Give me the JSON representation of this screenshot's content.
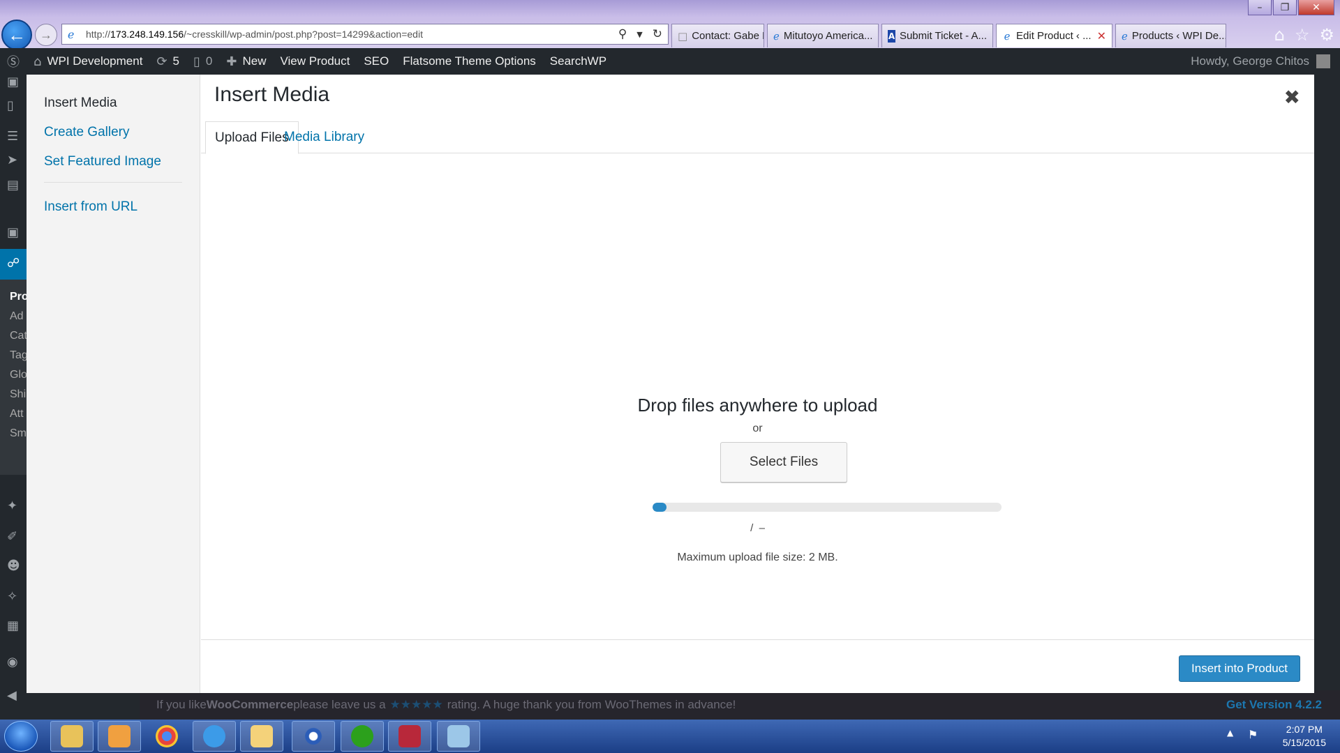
{
  "browser": {
    "url_prefix": "http://",
    "url_host": "173.248.149.156",
    "url_path": "/~cresskill/wp-admin/post.php?post=14299&action=edit",
    "tabs": [
      {
        "label": "Contact: Gabe Mu...",
        "icon": "page-icon",
        "active": false
      },
      {
        "label": "Mitutoyo America...",
        "icon": "ie-icon",
        "active": false
      },
      {
        "label": "Submit Ticket - A...",
        "icon": "blue-a-icon",
        "active": false
      },
      {
        "label": "Edit Product ‹ ...",
        "icon": "ie-icon",
        "active": true
      },
      {
        "label": "Products ‹ WPI De...",
        "icon": "ie-icon",
        "active": false
      }
    ]
  },
  "adminbar": {
    "site_name": "WPI Development",
    "updates_count": "5",
    "comments_count": "0",
    "new_label": "New",
    "view_product": "View Product",
    "seo": "SEO",
    "theme_options": "Flatsome Theme Options",
    "searchwp": "SearchWP",
    "howdy": "Howdy, George Chitos"
  },
  "sidebar": {
    "sub_items": [
      "Pro",
      "Ad",
      "Cat",
      "Tag",
      "Glo",
      "Shi",
      "Att",
      "Sm"
    ]
  },
  "footer": {
    "text_before": "If you like ",
    "brand": "WooCommerce",
    "text_mid": " please leave us a ",
    "stars": "★★★★★",
    "text_after": " rating. A huge thank you from WooThemes in advance!",
    "get_version": "Get Version 4.2.2"
  },
  "modal": {
    "menu": {
      "insert_media": "Insert Media",
      "create_gallery": "Create Gallery",
      "set_featured": "Set Featured Image",
      "insert_url": "Insert from URL"
    },
    "title": "Insert Media",
    "tabs": {
      "upload": "Upload Files",
      "library": "Media Library"
    },
    "uploader": {
      "drop_title": "Drop files anywhere to upload",
      "or": "or",
      "select_files": "Select Files",
      "progress_percent": 4,
      "progress_text": "/  –",
      "max_size": "Maximum upload file size: 2 MB."
    },
    "insert_button": "Insert into Product"
  },
  "taskbar": {
    "apps": [
      "file-explorer-icon",
      "media-player-icon",
      "chrome-icon",
      "internet-explorer-icon",
      "outlook-icon",
      "eye-app-icon",
      "quickbooks-icon",
      "acrobat-icon",
      "notepad-icon"
    ],
    "time": "2:07 PM",
    "date": "5/15/2015"
  },
  "colors": {
    "wp_blue": "#0073aa",
    "primary_button": "#2b8ac6",
    "admin_bar": "#23282d"
  }
}
